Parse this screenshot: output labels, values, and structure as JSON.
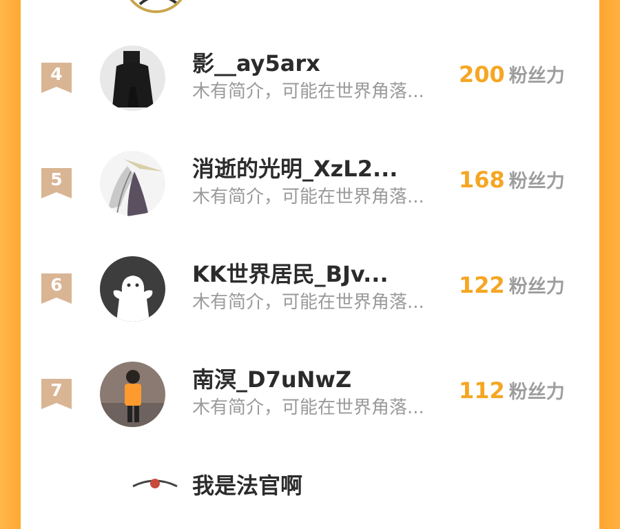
{
  "leaderboard": {
    "score_unit": "粉丝力",
    "rows": [
      {
        "rank": "4",
        "name": "影__ay5arx",
        "bio": "木有简介，可能在世界角落...",
        "score": "200"
      },
      {
        "rank": "5",
        "name": "消逝的光明_XzL2...",
        "bio": "木有简介，可能在世界角落...",
        "score": "168"
      },
      {
        "rank": "6",
        "name": "KK世界居民_BJv...",
        "bio": "木有简介，可能在世界角落...",
        "score": "122"
      },
      {
        "rank": "7",
        "name": "南溟_D7uNwZ",
        "bio": "木有简介，可能在世界角落...",
        "score": "112"
      }
    ],
    "partial_next_name": "我是法官啊"
  },
  "colors": {
    "accent": "#f5a623",
    "badge": "#d9b594",
    "border": "#ffa933"
  }
}
